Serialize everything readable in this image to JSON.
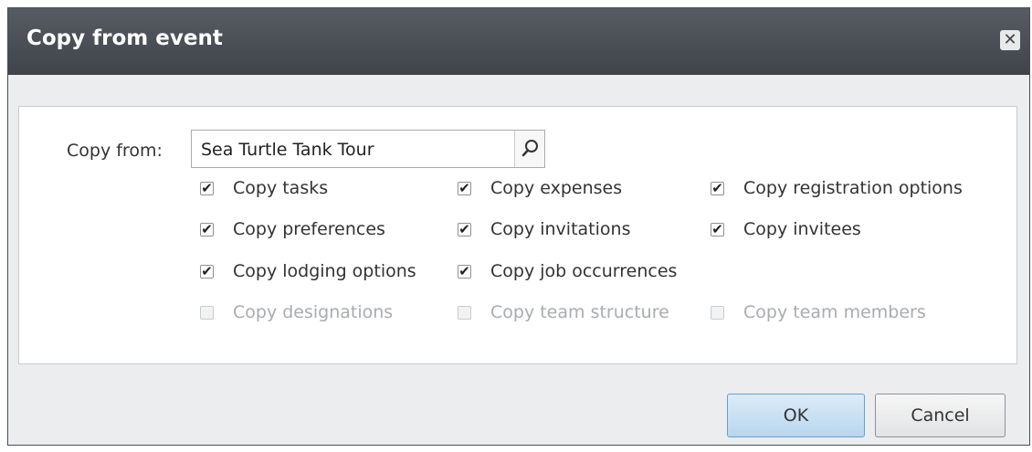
{
  "dialog": {
    "title": "Copy from event",
    "close_icon": "close-icon"
  },
  "copy_from": {
    "label": "Copy from:",
    "value": "Sea Turtle Tank Tour",
    "lookup_icon": "search-icon"
  },
  "options": [
    {
      "label": "Copy tasks",
      "checked": true,
      "enabled": true
    },
    {
      "label": "Copy expenses",
      "checked": true,
      "enabled": true
    },
    {
      "label": "Copy registration options",
      "checked": true,
      "enabled": true
    },
    {
      "label": "Copy preferences",
      "checked": true,
      "enabled": true
    },
    {
      "label": "Copy invitations",
      "checked": true,
      "enabled": true
    },
    {
      "label": "Copy invitees",
      "checked": true,
      "enabled": true
    },
    {
      "label": "Copy lodging options",
      "checked": true,
      "enabled": true
    },
    {
      "label": "Copy job occurrences",
      "checked": true,
      "enabled": true
    },
    {
      "label": "Copy designations",
      "checked": false,
      "enabled": false
    },
    {
      "label": "Copy team structure",
      "checked": false,
      "enabled": false
    },
    {
      "label": "Copy team members",
      "checked": false,
      "enabled": false
    }
  ],
  "buttons": {
    "ok": "OK",
    "cancel": "Cancel"
  }
}
